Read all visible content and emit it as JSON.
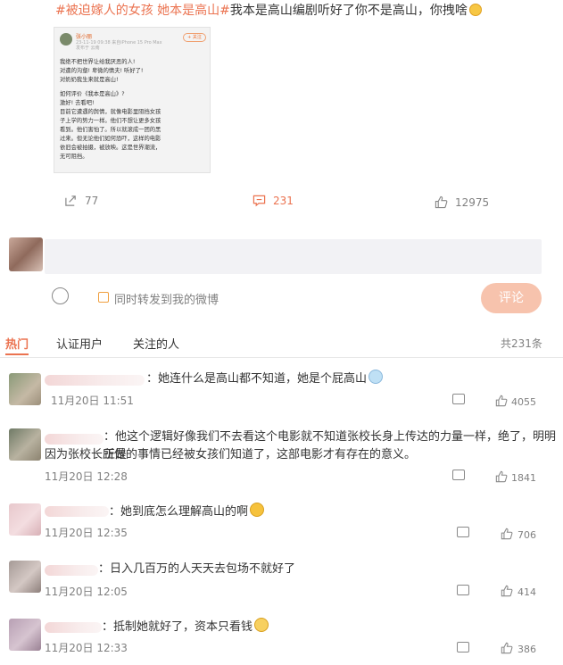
{
  "post": {
    "topic1": "#被迫嫁人的女孩 她本是高山#",
    "text": "我本是高山编剧听好了你不是高山，你拽啥",
    "image": {
      "username": "张小丽",
      "meta": "23-11-19 09:38  来自iPhone 15 Pro Max",
      "location": "发布于 云南",
      "follow": "+ 关注",
      "lines": [
        "我绝不把世界让给我厌恶的人!",
        "对遭的沟壑! 卑微的情夫! 听好了!",
        "对奶奶我生来就是高山!",
        "",
        "如何评价《我本是高山》?",
        "激好! 去看吧!",
        "目前它遭遇的舆情，就像电影里阻挡女孩",
        "子上学的势力一样。他们不想让更多女孩",
        "看到。他们害怕了。所以就滚成一团的黑",
        "过来。但无论他们如何恐吓，这样的电影",
        "依旧会被拍摄，被放映。这是世界潮流，",
        "无可阻挡。"
      ]
    },
    "actions": {
      "repost": "77",
      "comment": "231",
      "like": "12975"
    }
  },
  "composer": {
    "repost_label": "同时转发到我的微博",
    "submit": "评论"
  },
  "tabs": [
    "热门",
    "认证用户",
    "关注的人"
  ],
  "total": "共231条",
  "comments": [
    {
      "text": "：她连什么是高山都不知道，她是个屁高山",
      "time": "11月20日 11:51",
      "likes": "4055"
    },
    {
      "text": "：他这个逻辑好像我们不去看这个电影就不知道张校长身上传达的力量一样，绝了，明明正是",
      "text2": "因为张校长所做的事情已经被女孩们知道了，这部电影才有存在的意义。",
      "time": "11月20日 12:28",
      "likes": "1841"
    },
    {
      "text": "：她到底怎么理解高山的啊",
      "time": "11月20日 12:35",
      "likes": "706"
    },
    {
      "text": "：日入几百万的人天天去包场不就好了",
      "time": "11月20日 12:05",
      "likes": "414"
    },
    {
      "text": "：抵制她就好了，资本只看钱",
      "time": "11月20日 12:33",
      "likes": "386"
    }
  ],
  "colors": {
    "accent": "#eb7350",
    "submit_bg": "#f7c3ad",
    "input_bg": "#f2f2f5"
  }
}
